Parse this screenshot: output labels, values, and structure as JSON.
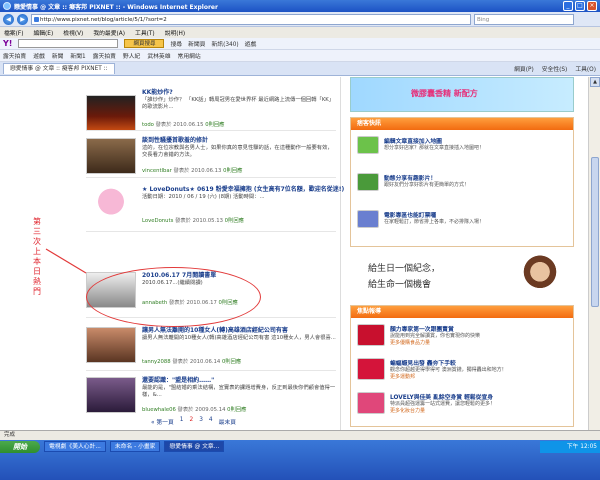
{
  "window": {
    "title": "戀愛情事 @ 文章 :: 癡客邦 PIXNET :: - Windows Internet Explorer",
    "btn_min": "_",
    "btn_max": "□",
    "btn_close": "×"
  },
  "address": {
    "url": "http://www.pixnet.net/blog/article/5/1/?sort=2",
    "search_placeholder": "Bing",
    "back": "◀",
    "forward": "▶"
  },
  "menu": [
    "檔案(F)",
    "編輯(E)",
    "檢視(V)",
    "我的最愛(A)",
    "工具(T)",
    "說明(H)"
  ],
  "yahoo_bar": {
    "logo": "Y!",
    "search_button": "網頁搜尋",
    "items": [
      "搜尋",
      "新聞頁",
      "新訊(340)",
      "遊戲"
    ]
  },
  "links_bar": [
    "露天拍賣",
    "遊戲",
    "新聞",
    "新聞1",
    "露天拍賣",
    "野人紀",
    "武林英雄",
    "常用網站"
  ],
  "tab": {
    "label": "戀愛情事 @ 文章 :: 癡客邦 PIXNET ::",
    "tools": [
      "網頁(P)",
      "安全性(S)",
      "工具(O)"
    ]
  },
  "posts": [
    {
      "title": "KK能炒作?",
      "excerpt": "「誰炒作」炒作？ 「KK話」轉周冠男在愛世界杯 最近網路上流傳一個回轉「KK」的歌流影片...",
      "author": "todo",
      "date": "發表於 2010.06.15",
      "reply": "0則回應"
    },
    {
      "title": "談到性騷擾首歌羞的修計",
      "excerpt": "這的，在位宗教與名男人士，如果你真的意見性驟的話，在這種動作一般要有效，交長看力會錯的方法。",
      "author": "vincentlbar",
      "date": "發表於 2010.06.13",
      "reply": "0則回應"
    },
    {
      "title": "★ LoveDonuts★ 0619 粉愛幸福擁抱 (女生高有7位名額，歡迎名從迷!)",
      "excerpt": "活動日期：2010 / 06 / 19 (六) (8期) 活動時間：...",
      "author": "LoveDonuts",
      "date": "發表於 2010.05.13",
      "reply": "0則回應"
    },
    {
      "title": "2010.06.17 7月閱讀書單",
      "excerpt": "2010.06.17...(繼續閱讀)",
      "author": "annabeth",
      "date": "發表於 2010.06.17",
      "reply": "0則回應"
    },
    {
      "title": "讓男人無法離開的10種女人(轉)高雄酒店經紀公司有害",
      "excerpt": "讓男人無法離開的10種女人(轉)高雄酒店經紀公司有害     這10種女人，男人會很喜...",
      "author": "tanny2088",
      "date": "發表於 2010.06.14",
      "reply": "0則回應"
    },
    {
      "title": "還要認識：\"盟是相約……\"",
      "excerpt": "最能的是，\"盟結婚的乘法結構，宣實表的課題增費身，反正到最後你們顧會值得一樣，&...",
      "author": "bluewhale06",
      "date": "發表於 2009.05.14",
      "reply": "0則回應"
    }
  ],
  "continue_label": "(繼續閱讀)",
  "pager": {
    "first": "« 第一頁",
    "prev": "1",
    "cur": "2",
    "next": "3",
    "last": "4",
    "end": "最末頁"
  },
  "annotation": "第三次上本日熱門",
  "sidebar": {
    "banner_text": "微膠囊香精 新配方",
    "box1_title": "痞客快訊",
    "box1_items": [
      {
        "title": "編輯文章直接加入地圖",
        "desc": "想分享好店家？那就在文章直接插入地圖吧！"
      },
      {
        "title": "動態分享有趣影片！",
        "desc": "跟好友們分享好影片有更簡單的方式！"
      },
      {
        "title": "電影專區也能訂票囉",
        "desc": "在家輕鬆訂，節省排上各車，不必排隊入場！"
      }
    ],
    "ad_line1": "給生日一個紀念，",
    "ad_line2": "給生命一個機會",
    "box2_title": "焦點報導",
    "box2_items": [
      {
        "title": "顏力專家第一次跟團賣賞",
        "desc": "說能用到完全解讀賞，你也實現你的快樂",
        "more": "更多優購食品力量"
      },
      {
        "title": "蝙蝠蝦見出發 轟夯下手較",
        "desc": "觀念你超越更得學得可 澳洲賞錢，獨得轟出和地方！",
        "more": "更多運動邦"
      },
      {
        "title": "LOVELY與佳美 亂餘空身賞 輕鬆從宣身",
        "desc": "特派員超強運籌一站式運費，讓您輕鬆的更多！",
        "more": "更多化妝台力量"
      }
    ]
  },
  "status_text": "完成",
  "taskbar": {
    "start": "開始",
    "tasks": [
      "電視劇《美人心計...",
      "未命名 - 小畫家",
      "戀愛情事 @ 文章..."
    ],
    "time": "下午 12:05"
  }
}
